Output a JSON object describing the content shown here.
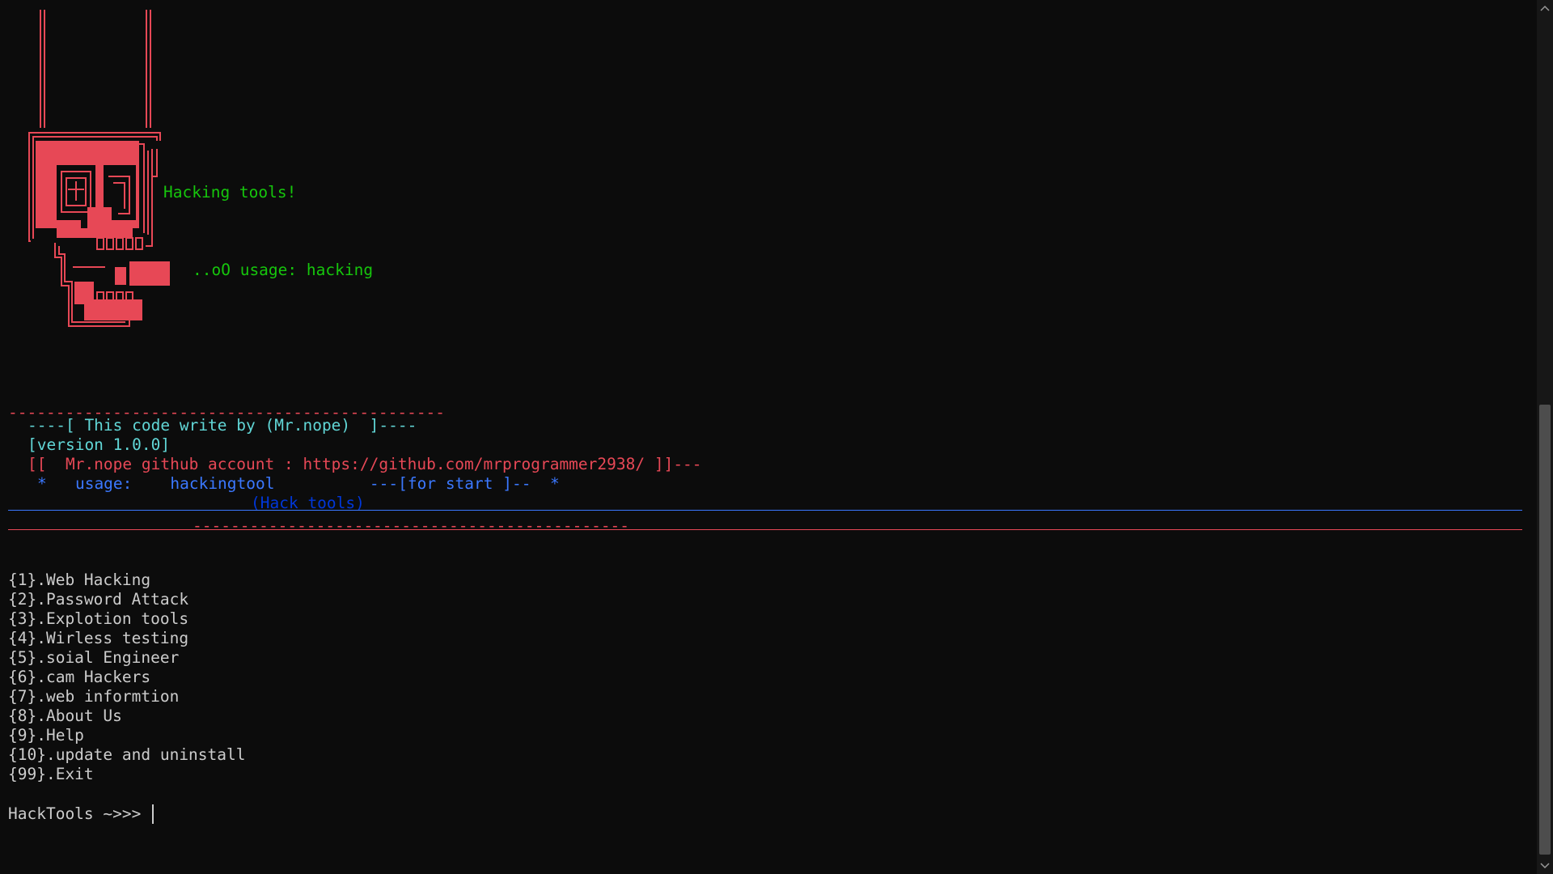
{
  "banner": {
    "tagline": "Hacking tools!",
    "usage_hint": "..oO usage: hacking"
  },
  "credits": {
    "top_rule": "----------------------------------------------",
    "author_line": "----[ This code write by (Mr.nope)  ]----",
    "version": "[version 1.0.0]",
    "github_line": "[[  Mr.nope github account : https://github.com/mrprogrammer2938/ ]]---",
    "usage_line": "*   usage:    hackingtool          ---[for start ]--  *",
    "title": "(Hack tools)",
    "bottom_rule": "----------------------------------------------"
  },
  "menu": {
    "items": [
      {
        "label": "{1}.Web Hacking"
      },
      {
        "label": "{2}.Password Attack"
      },
      {
        "label": "{3}.Explotion tools"
      },
      {
        "label": "{4}.Wirless testing"
      },
      {
        "label": "{5}.soial Engineer"
      },
      {
        "label": "{6}.cam Hackers"
      },
      {
        "label": "{7}.web informtion"
      },
      {
        "label": "{8}.About Us"
      },
      {
        "label": "{9}.Help"
      },
      {
        "label": "{10}.update and uninstall"
      },
      {
        "label": "{99}.Exit"
      }
    ]
  },
  "prompt": {
    "text": "HackTools ~>>> "
  },
  "icons": {
    "skull": "skull-ascii-art-icon",
    "scroll_up": "chevron-up-icon",
    "scroll_down": "chevron-down-icon"
  },
  "colors": {
    "background": "#0c0c0c",
    "skull_red": "#e74856",
    "banner_green": "#16c60c",
    "credit_cyan": "#61d6d6",
    "usage_blue": "#3b78ff",
    "title_dark_blue": "#0037da",
    "menu_text": "#cccccc"
  }
}
